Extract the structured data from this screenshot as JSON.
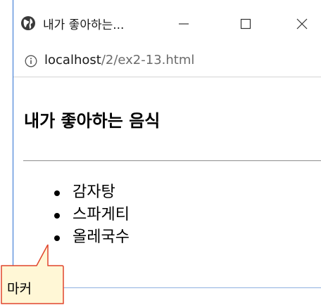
{
  "window": {
    "title": "내가 좋아하는...",
    "minimize_glyph": "—",
    "maximize_glyph": "☐",
    "close_glyph": "✕"
  },
  "address_bar": {
    "host": "localhost",
    "path": "/2/ex2-13.html"
  },
  "page": {
    "heading": "내가 좋아하는 음식",
    "foods": [
      "감자탕",
      "스파게티",
      "올레국수"
    ]
  },
  "annotation": {
    "label": "마커",
    "fill": "#fff7d6",
    "stroke": "#e0452b"
  }
}
